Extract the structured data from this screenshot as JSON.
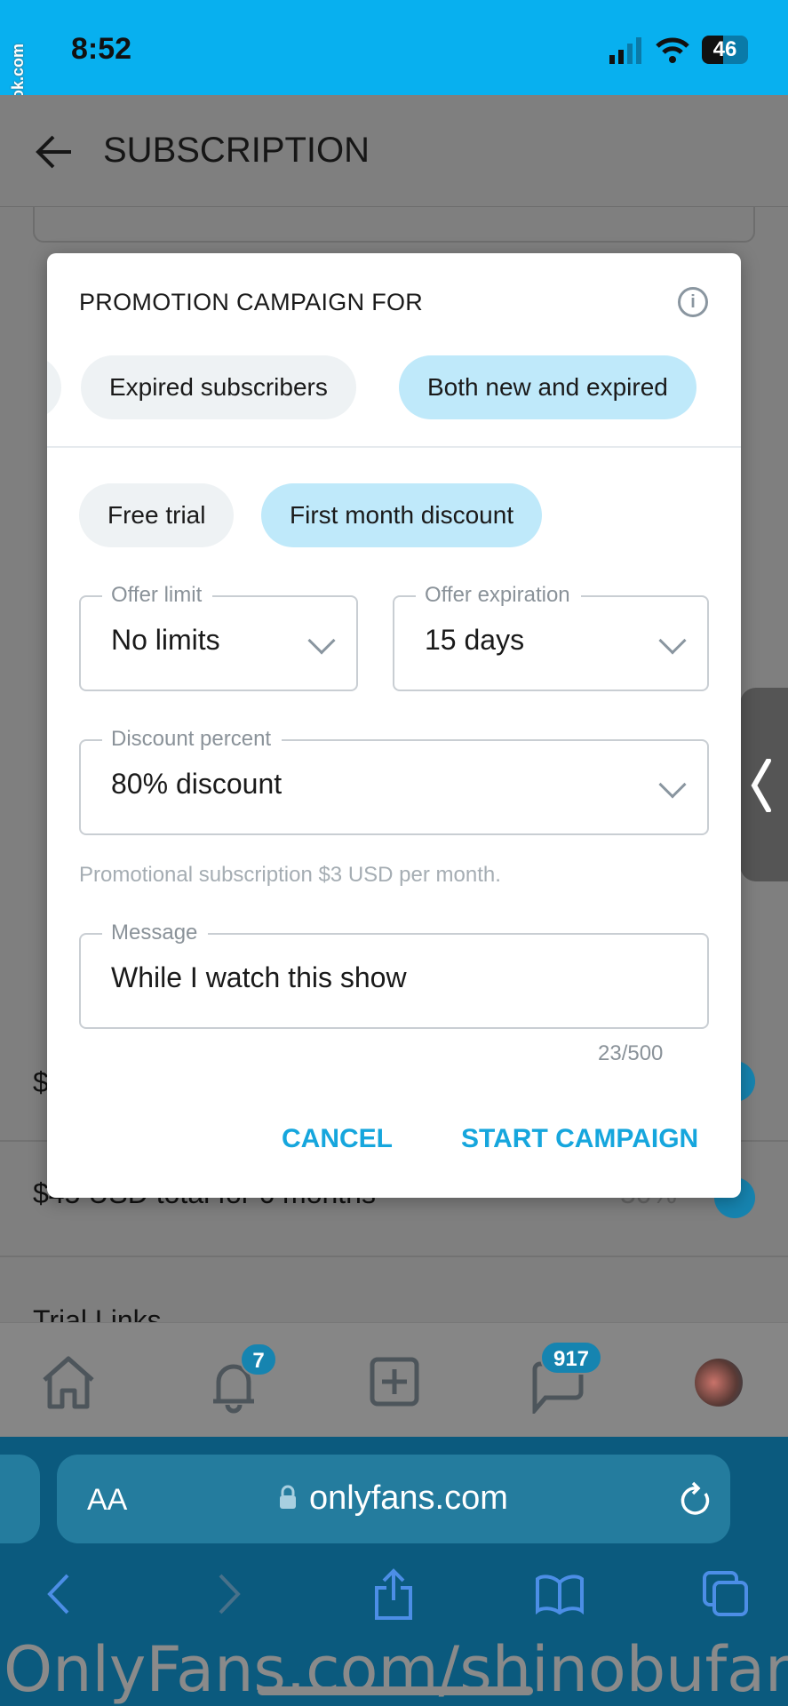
{
  "status_bar": {
    "time": "8:52",
    "battery": "46",
    "watermark": "fappeningbook.com"
  },
  "header": {
    "title": "SUBSCRIPTION"
  },
  "background": {
    "row_partial_1": "$",
    "row_2": "$45 USD total for 6 months",
    "row_2_value": "50%",
    "section": "Trial Links"
  },
  "modal": {
    "title": "PROMOTION CAMPAIGN FOR",
    "audience_chips": [
      {
        "label": "Expired subscribers",
        "selected": false
      },
      {
        "label": "Both new and expired",
        "selected": true
      }
    ],
    "type_chips": [
      {
        "label": "Free trial",
        "selected": false
      },
      {
        "label": "First month discount",
        "selected": true
      }
    ],
    "offer_limit": {
      "label": "Offer limit",
      "value": "No limits"
    },
    "offer_expiration": {
      "label": "Offer expiration",
      "value": "15 days"
    },
    "discount_percent": {
      "label": "Discount percent",
      "value": "80% discount"
    },
    "helper": "Promotional subscription $3 USD per month.",
    "message": {
      "label": "Message",
      "value": "While I watch this show"
    },
    "counter": "23/500",
    "cancel": "CANCEL",
    "start": "START CAMPAIGN"
  },
  "bottom_nav": {
    "notifications_badge": "7",
    "messages_badge": "917"
  },
  "browser": {
    "aa": "AA",
    "url": "onlyfans.com"
  },
  "overlay_text": "OnlyFans.com/shinobufan",
  "colors": {
    "accent": "#16a6dd",
    "status_bar": "#08b0ef",
    "chip_selected": "#bfe9fa"
  }
}
